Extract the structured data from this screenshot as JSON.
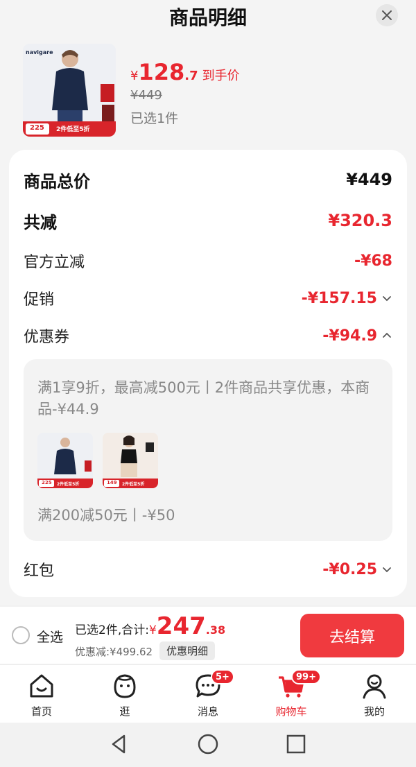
{
  "header": {
    "title": "商品明细"
  },
  "product": {
    "price_currency": "¥",
    "price_int": "128",
    "price_dec": ".7",
    "price_tag": "到手价",
    "original_price": "¥449",
    "selected_count": "已选1件",
    "thumb_brand": "navigare",
    "thumb_price": "225",
    "thumb_banner": "2件低至5折"
  },
  "summary": {
    "total_label": "商品总价",
    "total_value": "¥449",
    "reduce_label": "共减",
    "reduce_value": "¥320.3",
    "official_label": "官方立减",
    "official_value": "-¥68",
    "promo_label": "促销",
    "promo_value": "-¥157.15",
    "coupon_label": "优惠券",
    "coupon_value": "-¥94.9",
    "redpacket_label": "红包",
    "redpacket_value": "-¥0.25"
  },
  "coupon_detail": {
    "description": "满1享9折，最高减500元丨2件商品共享优惠，本商品-¥44.9",
    "item1_price": "225",
    "item1_banner": "2件低至5折",
    "item2_price": "149",
    "item2_banner": "2件低至5折",
    "rule": "满200减50元丨-¥50"
  },
  "checkout_bar": {
    "select_all": "全选",
    "selected_prefix": "已选2件,合计:",
    "currency": "¥",
    "total_int": "247",
    "total_dec": ".38",
    "discount": "优惠减:¥499.62",
    "detail_button": "优惠明细",
    "checkout_button": "去结算"
  },
  "tabbar": {
    "tabs": [
      {
        "label": "首页",
        "icon": "home-icon"
      },
      {
        "label": "逛",
        "icon": "stroll-icon"
      },
      {
        "label": "消息",
        "icon": "message-icon",
        "badge": "5+"
      },
      {
        "label": "购物车",
        "icon": "cart-icon",
        "badge": "99+",
        "active": true
      },
      {
        "label": "我的",
        "icon": "profile-icon"
      }
    ]
  },
  "colors": {
    "accent": "#e8262f",
    "checkout": "#f03a3f"
  }
}
